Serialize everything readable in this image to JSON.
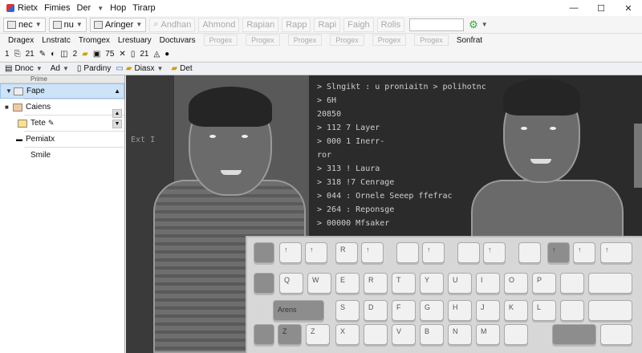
{
  "window": {
    "menu": [
      "Rietx",
      "Fimies",
      "Der",
      "Hop",
      "Tirarp"
    ],
    "controls": [
      "—",
      "☐",
      "✕"
    ]
  },
  "toolbar1": {
    "items": [
      {
        "label": "nec",
        "kind": "drop"
      },
      {
        "label": "nu",
        "kind": "drop"
      },
      {
        "label": "Aringer",
        "kind": "drop"
      },
      {
        "label": "Andhan",
        "kind": "ghost"
      },
      {
        "label": "Ahmond",
        "kind": "ghost"
      },
      {
        "label": "Rapian",
        "kind": "ghost"
      },
      {
        "label": "Rapp",
        "kind": "ghost"
      },
      {
        "label": "Rapi",
        "kind": "ghost"
      },
      {
        "label": "Faigh",
        "kind": "ghost"
      },
      {
        "label": "Rolis",
        "kind": "ghost"
      }
    ],
    "search_value": "",
    "gear": "⚙"
  },
  "toolbar2": {
    "items": [
      "Dragex",
      "Lnstratc",
      "Tromgex",
      "Lrestuary",
      "Doctuvars"
    ],
    "ghost": [
      "Progex",
      "Progex",
      "Progex",
      "Progex",
      "Progex",
      "Progex"
    ],
    "last": "Sonfrat"
  },
  "toolbar3": {
    "items": [
      "1",
      "21",
      "2",
      "75",
      "21"
    ]
  },
  "toolbar4": {
    "items": [
      "Dnoc",
      "Ad",
      "Pardiny",
      "Diasx",
      "Det"
    ]
  },
  "sidebar": {
    "header": "Prime",
    "items": [
      {
        "label": "Fape",
        "selected": true,
        "indent": 0
      },
      {
        "label": "Caiens",
        "indent": 0
      },
      {
        "label": "Tete",
        "indent": 1
      },
      {
        "label": "Pemiatx",
        "indent": 0
      },
      {
        "label": "Smile",
        "indent": 1
      }
    ]
  },
  "terminal": {
    "lines": [
      "> Slngikt : u proniaitn > polihotnc",
      "> 6H",
      "",
      "  20850",
      "",
      "> 112  7 Layer",
      "> 000  1 Inerr-",
      "",
      "  ror",
      "> 313  ! Laura",
      "> 318 !7 Cenrage",
      "> 044 : Ornele Seeep ffefrac",
      "> 264 :  Reponsge",
      "> 00000  Mfsaker"
    ],
    "left": [
      "Ext I"
    ]
  },
  "keyboard": {
    "row0": [
      "",
      "↑",
      "↑",
      "R",
      "↑",
      "",
      "↑",
      "",
      "↑",
      "",
      "↑",
      "↑",
      "↑"
    ],
    "row1": [
      "Q",
      "W",
      "E",
      "R",
      "T",
      "Y",
      "U",
      "I",
      "O",
      "P",
      "",
      "",
      ""
    ],
    "row2": [
      "Arens",
      "S",
      "D",
      "F",
      "G",
      "H",
      "J",
      "K",
      "L",
      "",
      "",
      ""
    ],
    "row3": [
      "Z",
      "Z",
      "X",
      "",
      "V",
      "B",
      "N",
      "M",
      "",
      "",
      "",
      ""
    ]
  }
}
